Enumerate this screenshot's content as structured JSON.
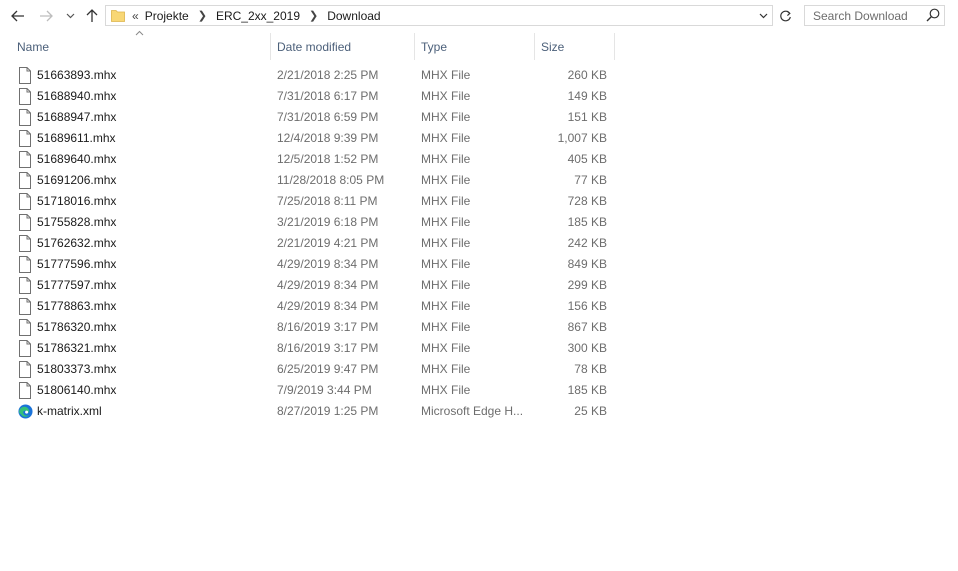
{
  "toolbar": {
    "back_icon": "arrow-left-icon",
    "forward_icon": "arrow-right-icon",
    "recent_icon": "chevron-down-icon",
    "up_icon": "arrow-up-icon"
  },
  "address": {
    "overflow": "«",
    "breadcrumb": [
      {
        "label": "Projekte"
      },
      {
        "label": "ERC_2xx_2019"
      },
      {
        "label": "Download"
      }
    ]
  },
  "search": {
    "placeholder": "Search Download"
  },
  "columns": {
    "name": "Name",
    "date": "Date modified",
    "type": "Type",
    "size": "Size",
    "sorted_by": "name"
  },
  "files": [
    {
      "name": "51663893.mhx",
      "date": "2/21/2018 2:25 PM",
      "type": "MHX File",
      "size": "260 KB",
      "icon": "file-icon"
    },
    {
      "name": "51688940.mhx",
      "date": "7/31/2018 6:17 PM",
      "type": "MHX File",
      "size": "149 KB",
      "icon": "file-icon"
    },
    {
      "name": "51688947.mhx",
      "date": "7/31/2018 6:59 PM",
      "type": "MHX File",
      "size": "151 KB",
      "icon": "file-icon"
    },
    {
      "name": "51689611.mhx",
      "date": "12/4/2018 9:39 PM",
      "type": "MHX File",
      "size": "1,007 KB",
      "icon": "file-icon"
    },
    {
      "name": "51689640.mhx",
      "date": "12/5/2018 1:52 PM",
      "type": "MHX File",
      "size": "405 KB",
      "icon": "file-icon"
    },
    {
      "name": "51691206.mhx",
      "date": "11/28/2018 8:05 PM",
      "type": "MHX File",
      "size": "77 KB",
      "icon": "file-icon"
    },
    {
      "name": "51718016.mhx",
      "date": "7/25/2018 8:11 PM",
      "type": "MHX File",
      "size": "728 KB",
      "icon": "file-icon"
    },
    {
      "name": "51755828.mhx",
      "date": "3/21/2019 6:18 PM",
      "type": "MHX File",
      "size": "185 KB",
      "icon": "file-icon"
    },
    {
      "name": "51762632.mhx",
      "date": "2/21/2019 4:21 PM",
      "type": "MHX File",
      "size": "242 KB",
      "icon": "file-icon"
    },
    {
      "name": "51777596.mhx",
      "date": "4/29/2019 8:34 PM",
      "type": "MHX File",
      "size": "849 KB",
      "icon": "file-icon"
    },
    {
      "name": "51777597.mhx",
      "date": "4/29/2019 8:34 PM",
      "type": "MHX File",
      "size": "299 KB",
      "icon": "file-icon"
    },
    {
      "name": "51778863.mhx",
      "date": "4/29/2019 8:34 PM",
      "type": "MHX File",
      "size": "156 KB",
      "icon": "file-icon"
    },
    {
      "name": "51786320.mhx",
      "date": "8/16/2019 3:17 PM",
      "type": "MHX File",
      "size": "867 KB",
      "icon": "file-icon"
    },
    {
      "name": "51786321.mhx",
      "date": "8/16/2019 3:17 PM",
      "type": "MHX File",
      "size": "300 KB",
      "icon": "file-icon"
    },
    {
      "name": "51803373.mhx",
      "date": "6/25/2019 9:47 PM",
      "type": "MHX File",
      "size": "78 KB",
      "icon": "file-icon"
    },
    {
      "name": "51806140.mhx",
      "date": "7/9/2019 3:44 PM",
      "type": "MHX File",
      "size": "185 KB",
      "icon": "file-icon"
    },
    {
      "name": "k-matrix.xml",
      "date": "8/27/2019 1:25 PM",
      "type": "Microsoft Edge H...",
      "size": "25 KB",
      "icon": "edge-icon"
    }
  ],
  "colors": {
    "header_text": "#4c607a",
    "secondary_text": "#6d6d6d",
    "folder": "#f8d775",
    "edge_blue": "#1a73d9",
    "edge_green": "#35c07a"
  }
}
